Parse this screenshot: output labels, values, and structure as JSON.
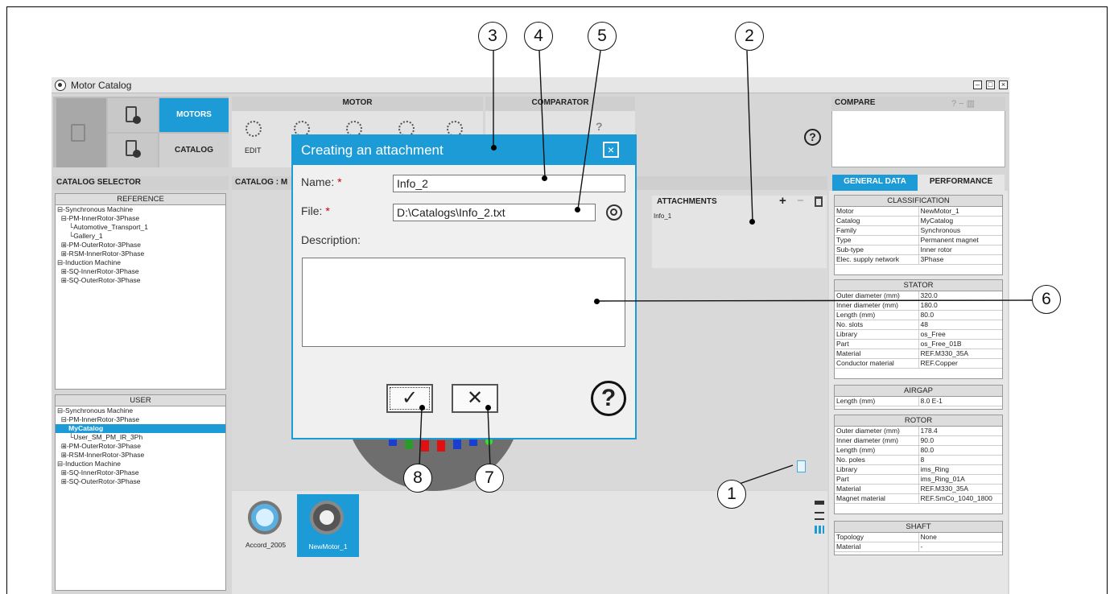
{
  "window": {
    "title": "Motor Catalog",
    "minimize": "–",
    "restore": "□",
    "close": "×"
  },
  "ribbon": {
    "motors_label": "MOTORS",
    "catalog_label": "CATALOG",
    "motor_group_label": "MOTOR",
    "comparator_group_label": "COMPARATOR",
    "edit_label": "EDIT",
    "help_glyph": "?",
    "compare_label": "COMPARE"
  },
  "catalog_selector": {
    "header": "CATALOG SELECTOR",
    "reference": {
      "title": "REFERENCE",
      "items": [
        "⊟-Synchronous Machine",
        "  ⊟-PM-InnerRotor-3Phase",
        "      └Automotive_Transport_1",
        "      └Gallery_1",
        "  ⊞-PM-OuterRotor-3Phase",
        "  ⊞-RSM-InnerRotor-3Phase",
        "⊟-Induction Machine",
        "  ⊞-SQ-InnerRotor-3Phase",
        "  ⊞-SQ-OuterRotor-3Phase"
      ]
    },
    "user": {
      "title": "USER",
      "items": [
        "⊟-Synchronous Machine",
        "  ⊟-PM-InnerRotor-3Phase",
        "      MyCatalog",
        "      └User_SM_PM_IR_3Ph",
        "  ⊞-PM-OuterRotor-3Phase",
        "  ⊞-RSM-InnerRotor-3Phase",
        "⊟-Induction Machine",
        "  ⊞-SQ-InnerRotor-3Phase",
        "  ⊞-SQ-OuterRotor-3Phase"
      ],
      "selected_index": 2
    }
  },
  "center": {
    "catalog_header": "CATALOG : M",
    "attachments": {
      "header": "ATTACHMENTS",
      "add": "+",
      "remove": "−",
      "items": [
        "Info_1"
      ]
    },
    "motors": [
      {
        "name": "Accord_2005"
      },
      {
        "name": "NewMotor_1"
      }
    ]
  },
  "right": {
    "tabs": [
      "GENERAL DATA",
      "PERFORMANCE"
    ],
    "classification": {
      "title": "CLASSIFICATION",
      "rows": [
        [
          "Motor",
          "NewMotor_1"
        ],
        [
          "Catalog",
          "MyCatalog"
        ],
        [
          "Family",
          "Synchronous"
        ],
        [
          "Type",
          "Permanent magnet"
        ],
        [
          "Sub-type",
          "Inner rotor"
        ],
        [
          "Elec. supply network",
          "3Phase"
        ]
      ]
    },
    "stator": {
      "title": "STATOR",
      "rows": [
        [
          "Outer diameter (mm)",
          "320.0"
        ],
        [
          "Inner diameter (mm)",
          "180.0"
        ],
        [
          "Length (mm)",
          "80.0"
        ],
        [
          "No. slots",
          "48"
        ],
        [
          "Library",
          "os_Free"
        ],
        [
          "Part",
          "os_Free_01B"
        ],
        [
          "Material",
          "REF.M330_35A"
        ],
        [
          "Conductor material",
          "REF.Copper"
        ]
      ]
    },
    "airgap": {
      "title": "AIRGAP",
      "rows": [
        [
          "Length (mm)",
          "8.0 E-1"
        ]
      ]
    },
    "rotor": {
      "title": "ROTOR",
      "rows": [
        [
          "Outer diameter (mm)",
          "178.4"
        ],
        [
          "Inner diameter (mm)",
          "90.0"
        ],
        [
          "Length (mm)",
          "80.0"
        ],
        [
          "No. poles",
          "8"
        ],
        [
          "Library",
          "ims_Ring"
        ],
        [
          "Part",
          "ims_Ring_01A"
        ],
        [
          "Material",
          "REF.M330_35A"
        ],
        [
          "Magnet material",
          "REF.SmCo_1040_1800"
        ]
      ]
    },
    "shaft": {
      "title": "SHAFT",
      "rows": [
        [
          "Topology",
          "None"
        ],
        [
          "Material",
          "-"
        ]
      ]
    }
  },
  "dialog": {
    "title": "Creating an attachment",
    "close": "×",
    "name_label": "Name:",
    "file_label": "File:",
    "required_mark": "*",
    "description_label": "Description:",
    "name_value": "Info_2",
    "file_value": "D:\\Catalogs\\Info_2.txt",
    "description_value": "",
    "ok_glyph": "✓",
    "cancel_glyph": "✕",
    "help_glyph": "?"
  },
  "callouts": [
    "1",
    "2",
    "3",
    "4",
    "5",
    "6",
    "7",
    "8"
  ]
}
